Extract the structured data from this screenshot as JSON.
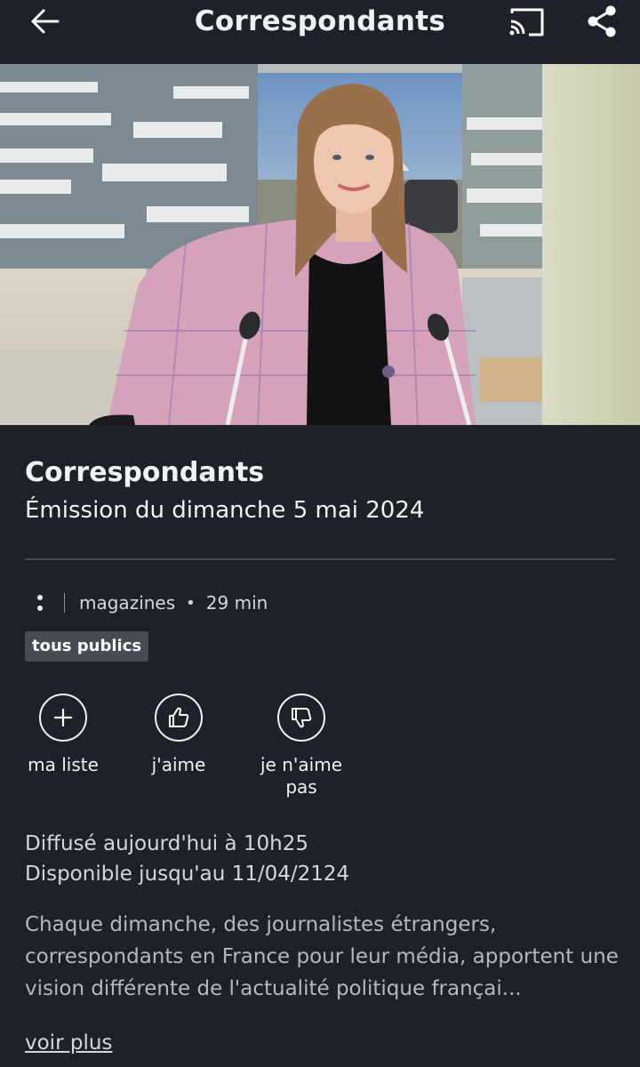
{
  "header": {
    "title": "Correspondants",
    "back_icon": "arrow-left-icon",
    "cast_icon": "cast-icon",
    "share_icon": "share-icon"
  },
  "hero": {
    "image": "presenter-in-studio"
  },
  "program": {
    "name": "Correspondants",
    "episode": "Émission du dimanche 5 mai 2024",
    "category": "magazines",
    "duration": "29 min",
    "rating": "tous publics"
  },
  "actions": [
    {
      "icon": "plus-icon",
      "label": "ma liste"
    },
    {
      "icon": "thumbs-up-icon",
      "label": "j'aime"
    },
    {
      "icon": "thumbs-down-icon",
      "label": "je n'aime pas"
    }
  ],
  "broadcast": {
    "aired": "Diffusé aujourd'hui à 10h25",
    "available": "Disponible jusqu'au 11/04/2124"
  },
  "description": "Chaque dimanche, des journalistes étrangers, correspondants en France pour leur média, apportent une vision différente de l'actualité politique françai...",
  "more_label": "voir plus",
  "colors": {
    "background": "#1e2128",
    "badge": "#474b53",
    "text": "#eef0f3"
  }
}
